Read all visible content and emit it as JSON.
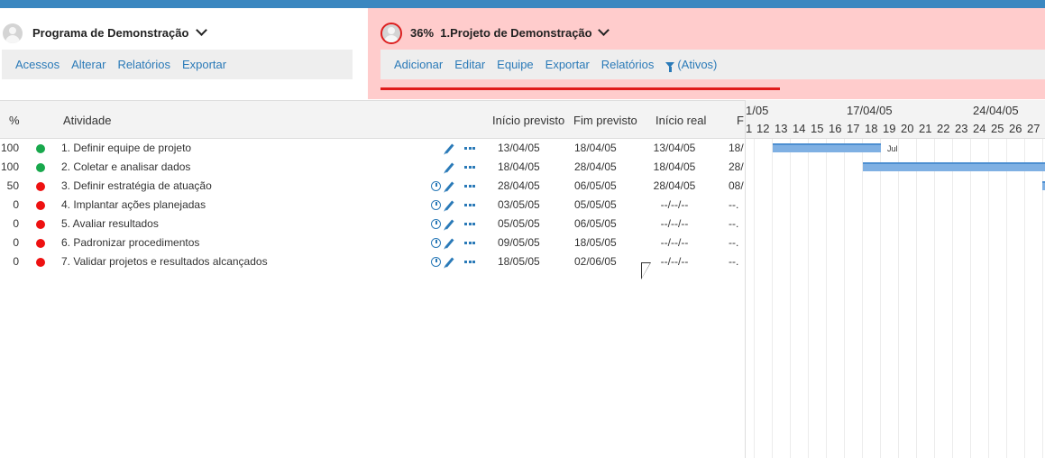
{
  "program": {
    "title": "Programa de Demonstração",
    "menu": [
      "Acessos",
      "Alterar",
      "Relatórios",
      "Exportar"
    ]
  },
  "project": {
    "percent": "36%",
    "title": "1.Projeto de Demonstração",
    "menu": [
      "Adicionar",
      "Editar",
      "Equipe",
      "Exportar",
      "Relatórios"
    ],
    "filter_label": "(Ativos)",
    "progress": 0.36,
    "progress_color": "#e01b1b",
    "panel_color": "#ffcccc"
  },
  "table": {
    "headers": {
      "pct": "%",
      "activity": "Atividade",
      "start_planned": "Início previsto",
      "end_planned": "Fim previsto",
      "start_real": "Início real",
      "end_real": "F"
    },
    "rows": [
      {
        "pct": "100",
        "status": "green",
        "name": "1. Definir equipe de projeto",
        "clock": false,
        "ini": "13/04/05",
        "fim": "18/04/05",
        "real": "13/04/05",
        "f": "18/"
      },
      {
        "pct": "100",
        "status": "green",
        "name": "2. Coletar e analisar dados",
        "clock": false,
        "ini": "18/04/05",
        "fim": "28/04/05",
        "real": "18/04/05",
        "f": "28/"
      },
      {
        "pct": "50",
        "status": "red",
        "name": "3. Definir estratégia de atuação",
        "clock": true,
        "ini": "28/04/05",
        "fim": "06/05/05",
        "real": "28/04/05",
        "f": "08/"
      },
      {
        "pct": "0",
        "status": "red",
        "name": "4. Implantar ações planejadas",
        "clock": true,
        "ini": "03/05/05",
        "fim": "05/05/05",
        "real": "--/--/--",
        "f": "--."
      },
      {
        "pct": "0",
        "status": "red",
        "name": "5. Avaliar resultados",
        "clock": true,
        "ini": "05/05/05",
        "fim": "06/05/05",
        "real": "--/--/--",
        "f": "--."
      },
      {
        "pct": "0",
        "status": "red",
        "name": "6. Padronizar procedimentos",
        "clock": true,
        "ini": "09/05/05",
        "fim": "18/05/05",
        "real": "--/--/--",
        "f": "--."
      },
      {
        "pct": "0",
        "status": "red",
        "name": "7. Validar projetos e resultados alcançados",
        "clock": true,
        "ini": "18/05/05",
        "fim": "02/06/05",
        "real": "--/--/--",
        "f": "--."
      }
    ],
    "status_colors": {
      "green": "#18a84c",
      "red": "#ee1111"
    }
  },
  "gantt": {
    "weeks": [
      "1/05",
      "17/04/05",
      "24/04/05"
    ],
    "days": [
      "1",
      "12",
      "13",
      "14",
      "15",
      "16",
      "17",
      "18",
      "19",
      "20",
      "21",
      "22",
      "23",
      "24",
      "25",
      "26",
      "27"
    ],
    "bar_label": "Jul",
    "bar_color": "#7fb0e3"
  },
  "icons": {
    "edit": "pencil-icon",
    "more": "more-dots-icon",
    "clock": "clock-icon",
    "filter": "filter-icon",
    "user": "user-avatar-icon"
  }
}
